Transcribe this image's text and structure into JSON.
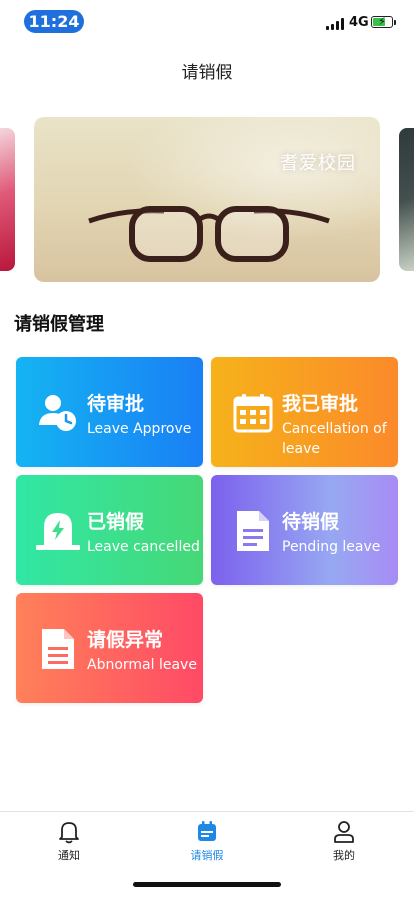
{
  "status_bar": {
    "time": "11:24",
    "network": "4G",
    "battery_color": "#39c24a"
  },
  "header": {
    "title": "请销假"
  },
  "banner": {
    "slogan": "耆爱校园",
    "images": [
      "glasses-photo",
      "flowers-photo",
      "campus-photo"
    ]
  },
  "section": {
    "title": "请销假管理"
  },
  "cards": [
    {
      "cn": "待审批",
      "en": "Leave Approve",
      "icon": "user-clock-icon",
      "colors": [
        "#14b4f2",
        "#1a7ff5"
      ]
    },
    {
      "cn": "我已审批",
      "en": "Cancellation of leave",
      "icon": "calendar-icon",
      "colors": [
        "#f6b21a",
        "#fb8a2a"
      ]
    },
    {
      "cn": "已销假",
      "en": "Leave cancelled",
      "icon": "power-plant-icon",
      "colors": [
        "#31e7a5",
        "#46d877"
      ]
    },
    {
      "cn": "待销假",
      "en": "Pending leave",
      "icon": "document-icon",
      "colors": [
        "#7c61ee",
        "#a78cf4"
      ]
    },
    {
      "cn": "请假异常",
      "en": "Abnormal leave",
      "icon": "document-icon",
      "colors": [
        "#ff8159",
        "#ff4a66"
      ]
    }
  ],
  "tabbar": {
    "items": [
      {
        "label": "通知",
        "icon": "bell-icon",
        "active": false
      },
      {
        "label": "请销假",
        "icon": "calendar-icon",
        "active": true
      },
      {
        "label": "我的",
        "icon": "person-icon",
        "active": false
      }
    ],
    "active_color": "#1e88e5"
  }
}
